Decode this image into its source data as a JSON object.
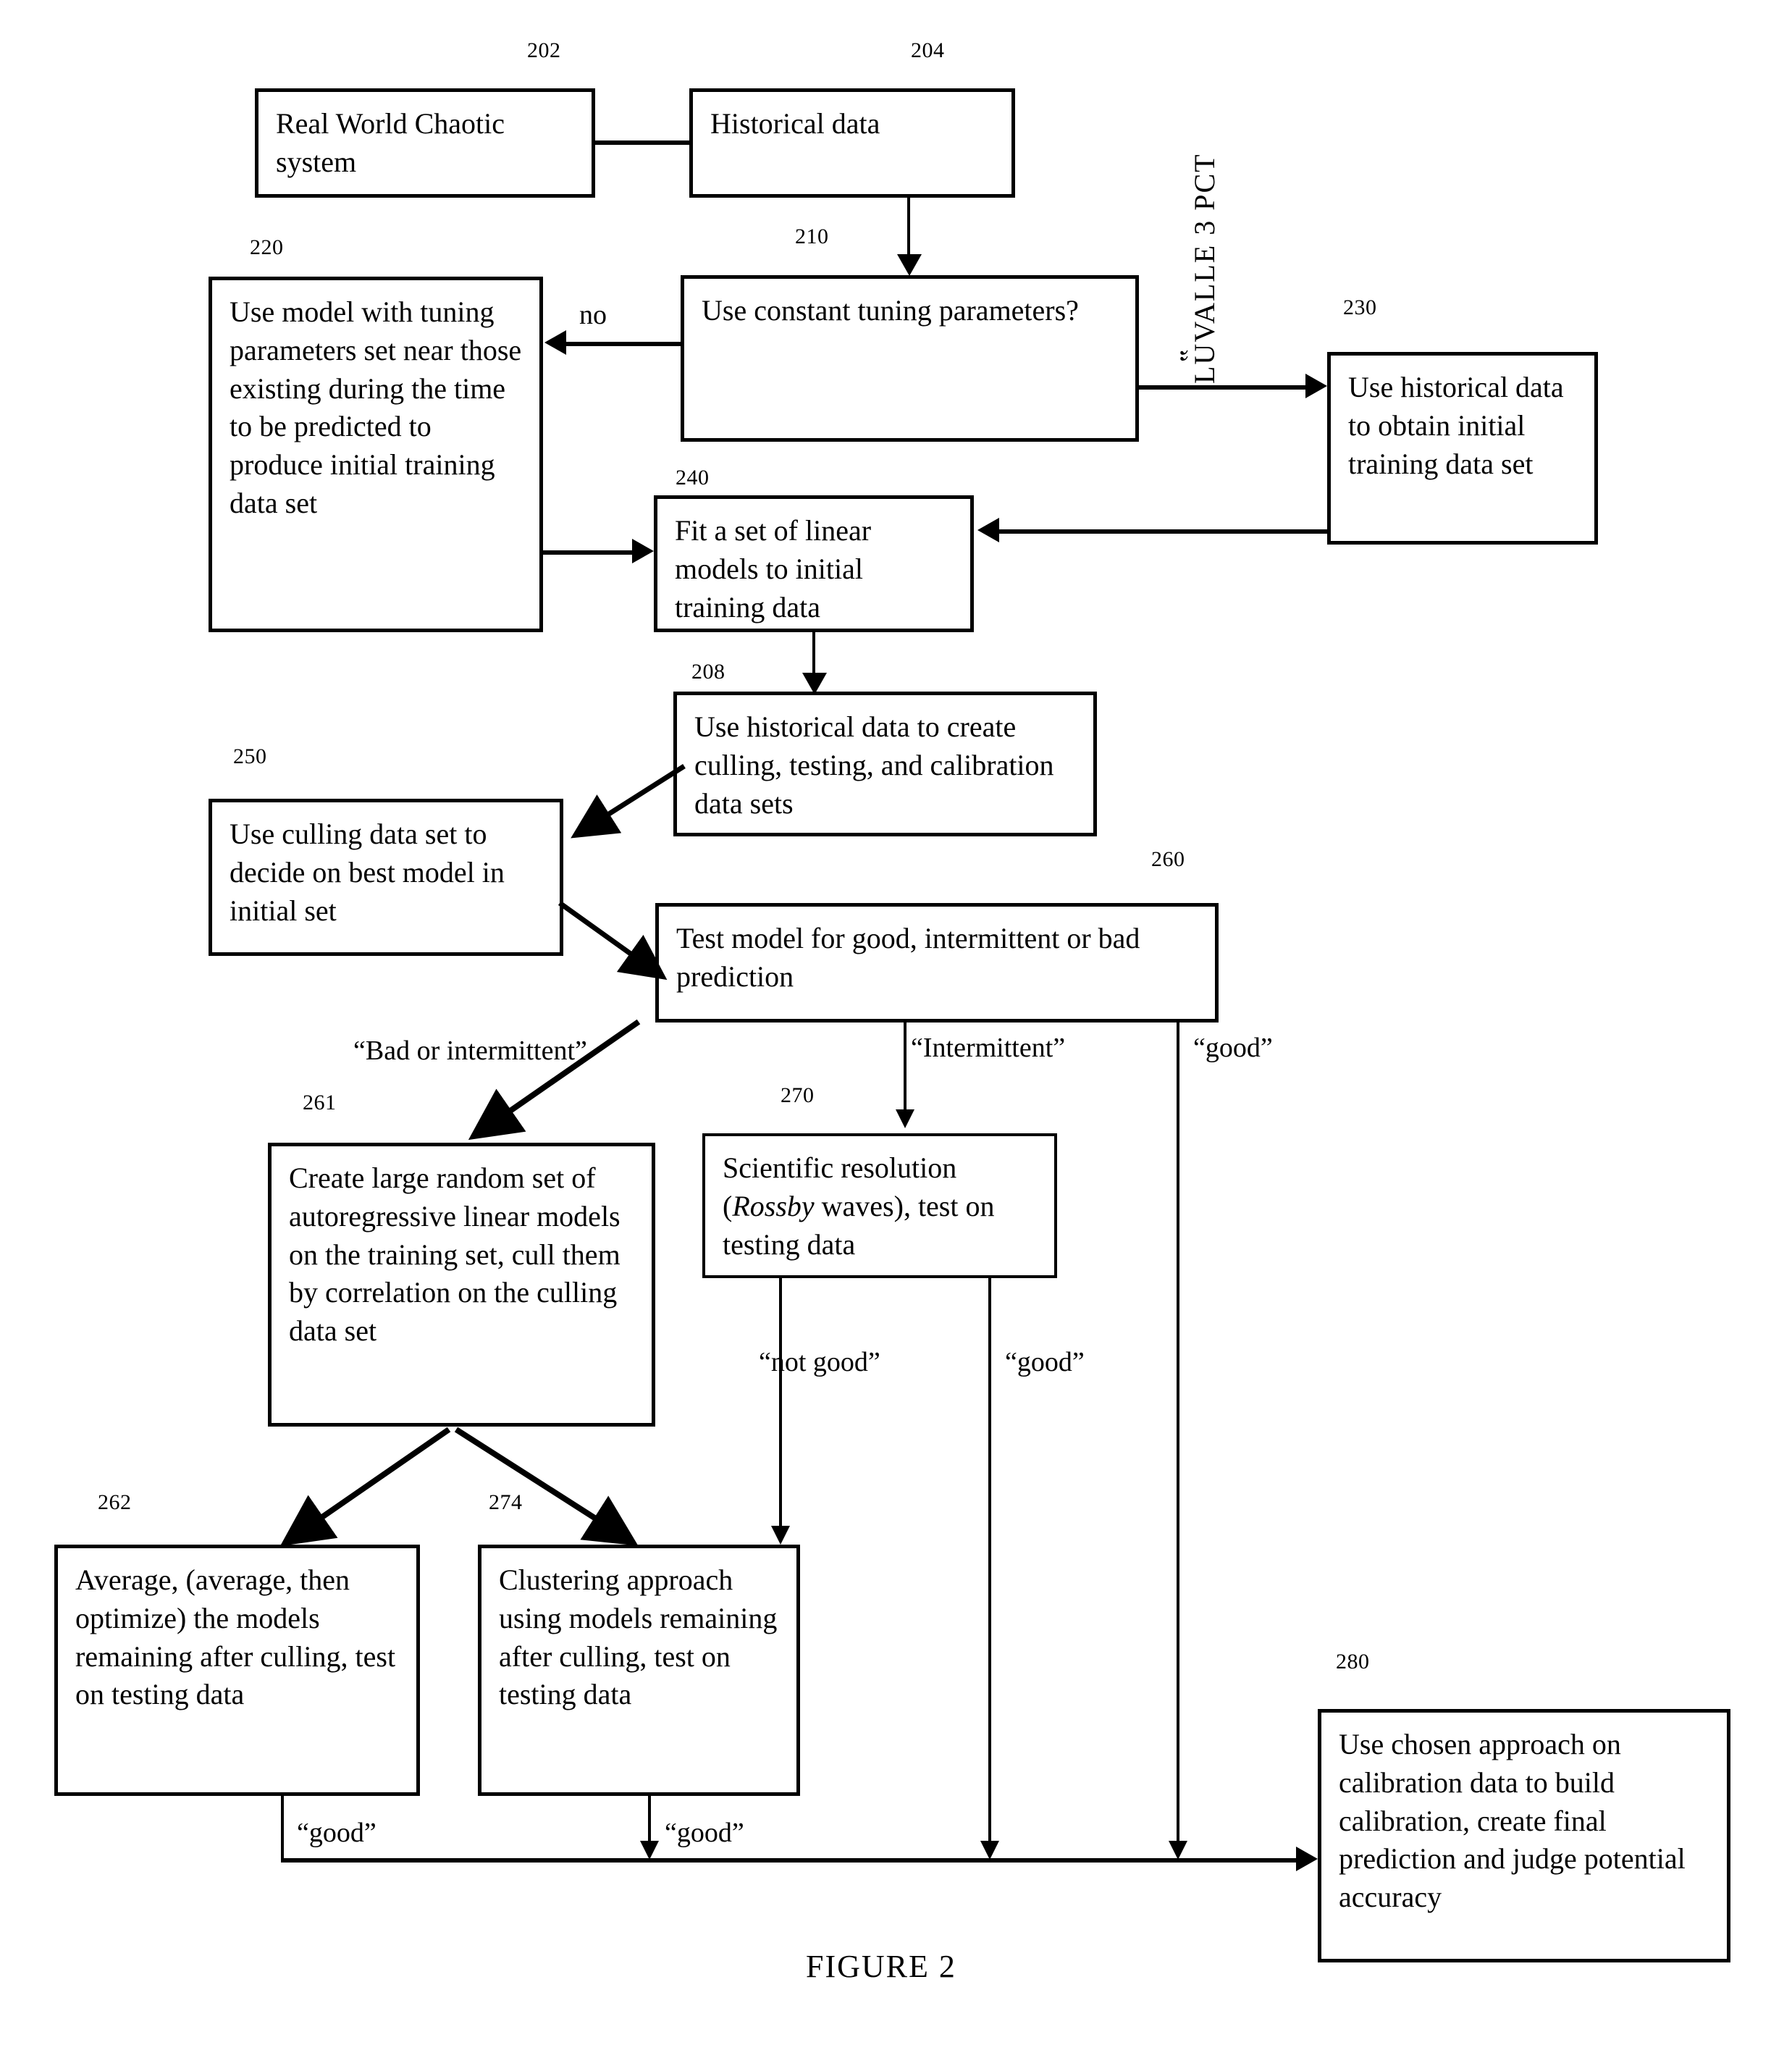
{
  "figure": {
    "caption": "FIGURE 2",
    "stamp": "LUVALLE 3 PCT"
  },
  "refs": {
    "r202": "202",
    "r204": "204",
    "r210": "210",
    "r220": "220",
    "r230": "230",
    "r240": "240",
    "r208": "208",
    "r250": "250",
    "r260": "260",
    "r261": "261",
    "r270": "270",
    "r262": "262",
    "r274": "274",
    "r280": "280"
  },
  "boxes": {
    "b202": "Real World Chaotic system",
    "b204": "Historical data",
    "b210": "Use constant tuning parameters?",
    "b220": "Use model with tuning parameters set near those existing during the time to be predicted to produce initial training data set",
    "b230": "Use historical data to obtain initial training data set",
    "b240": "Fit a set of linear models to initial training data",
    "b208": "Use historical data to create culling, testing, and calibration data sets",
    "b250": "Use culling data set to decide on best model in initial set",
    "b260": "Test model for good, intermittent or bad prediction",
    "b261": "Create large random set of autoregressive linear models on the training set, cull them by correlation on the culling data set",
    "b270_pre": "Scientific resolution (",
    "b270_italic": "Rossby",
    "b270_post": " waves), test on testing data",
    "b262": "Average, (average, then optimize) the models remaining after culling, test on testing data",
    "b274": "Clustering approach using models remaining after culling, test on testing data",
    "b280": "Use chosen approach on calibration data to build calibration, create final prediction and judge potential accuracy"
  },
  "edge_labels": {
    "no": "no",
    "bad_or_intermittent": "“Bad or intermittent”",
    "intermittent": "“Intermittent”",
    "good_260": "“good”",
    "not_good_270": "“not good”",
    "good_270": "“good”",
    "good_262": "“good”",
    "good_274": "“good”"
  }
}
